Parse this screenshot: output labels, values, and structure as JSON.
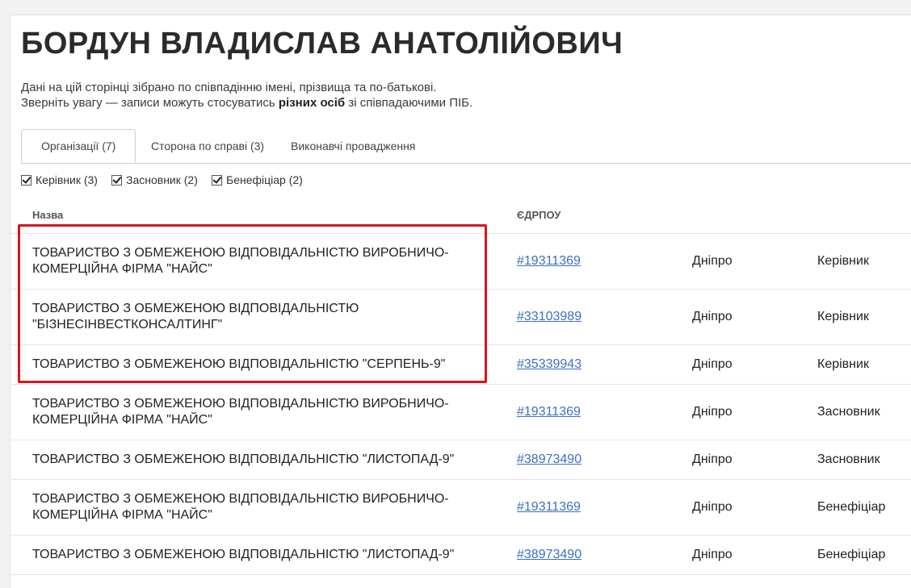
{
  "page": {
    "title": "БОРДУН ВЛАДИСЛАВ АНАТОЛІЙОВИЧ",
    "notice_line1": "Дані на цій сторінці зібрано по співпадінню імені, прізвища та по-батькові.",
    "notice_line2_prefix": "Зверніть увагу — записи можуть стосуватись ",
    "notice_line2_bold": "різних осіб",
    "notice_line2_suffix": " зі співпадаючими ПІБ."
  },
  "tabs": [
    {
      "label": "Організації (7)",
      "active": true
    },
    {
      "label": "Сторона по справі (3)",
      "active": false
    },
    {
      "label": "Виконавчі провадження",
      "active": false
    }
  ],
  "filters": [
    {
      "label": "Керівник (3)",
      "checked": true
    },
    {
      "label": "Засновник (2)",
      "checked": true
    },
    {
      "label": "Бенефіціар (2)",
      "checked": true
    }
  ],
  "table": {
    "headers": {
      "name": "Назва",
      "code": "ЄДРПОУ"
    },
    "rows": [
      {
        "name": "ТОВАРИСТВО З ОБМЕЖЕНОЮ ВІДПОВІДАЛЬНІСТЮ ВИРОБНИЧО-КОМЕРЦІЙНА ФІРМА \"НАЙС\"",
        "code": "#19311369",
        "city": "Дніпро",
        "role": "Керівник"
      },
      {
        "name": "ТОВАРИСТВО З ОБМЕЖЕНОЮ ВІДПОВІДАЛЬНІСТЮ \"БІЗНЕСІНВЕСТКОНСАЛТИНГ\"",
        "code": "#33103989",
        "city": "Дніпро",
        "role": "Керівник"
      },
      {
        "name": "ТОВАРИСТВО З ОБМЕЖЕНОЮ ВІДПОВІДАЛЬНІСТЮ \"СЕРПЕНЬ-9\"",
        "code": "#35339943",
        "city": "Дніпро",
        "role": "Керівник"
      },
      {
        "name": "ТОВАРИСТВО З ОБМЕЖЕНОЮ ВІДПОВІДАЛЬНІСТЮ ВИРОБНИЧО-КОМЕРЦІЙНА ФІРМА \"НАЙС\"",
        "code": "#19311369",
        "city": "Дніпро",
        "role": "Засновник"
      },
      {
        "name": "ТОВАРИСТВО З ОБМЕЖЕНОЮ ВІДПОВІДАЛЬНІСТЮ \"ЛИСТОПАД-9\"",
        "code": "#38973490",
        "city": "Дніпро",
        "role": "Засновник"
      },
      {
        "name": "ТОВАРИСТВО З ОБМЕЖЕНОЮ ВІДПОВІДАЛЬНІСТЮ ВИРОБНИЧО-КОМЕРЦІЙНА ФІРМА \"НАЙС\"",
        "code": "#19311369",
        "city": "Дніпро",
        "role": "Бенефіціар"
      },
      {
        "name": "ТОВАРИСТВО З ОБМЕЖЕНОЮ ВІДПОВІДАЛЬНІСТЮ \"ЛИСТОПАД-9\"",
        "code": "#38973490",
        "city": "Дніпро",
        "role": "Бенефіціар"
      }
    ]
  },
  "colors": {
    "link": "#3a6fc4",
    "highlight_border": "#d9141c"
  }
}
